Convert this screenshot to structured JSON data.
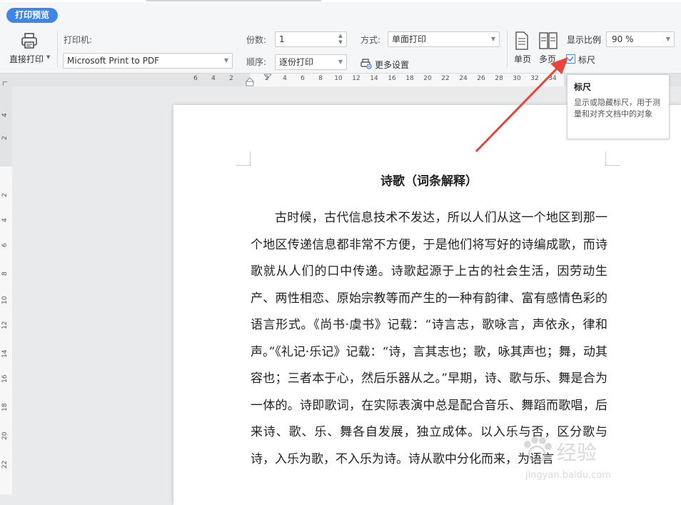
{
  "tab": {
    "label": "打印预览"
  },
  "direct_print": {
    "label": "直接打印"
  },
  "printer": {
    "label": "打印机:",
    "value": "Microsoft Print to PDF"
  },
  "copies": {
    "label": "份数:",
    "value": "1"
  },
  "order": {
    "label": "顺序:",
    "value": "逐份打印"
  },
  "mode": {
    "label": "方式:",
    "value": "单面打印"
  },
  "more_settings": {
    "label": "更多设置"
  },
  "single_page": {
    "label": "单页"
  },
  "multi_page": {
    "label": "多页"
  },
  "zoom": {
    "label": "显示比例",
    "value": "90 %"
  },
  "ruler_toggle": {
    "label": "标尺",
    "checked": true
  },
  "tooltip": {
    "title": "标尺",
    "description": "显示或隐藏标尺，用于测量和对齐文档中的对象"
  },
  "hruler_numbers": [
    "6",
    "4",
    "2",
    "2",
    "4",
    "6",
    "8",
    "10",
    "12",
    "14",
    "16",
    "18",
    "20",
    "22",
    "24",
    "26",
    "28",
    "30",
    "32",
    "34"
  ],
  "vruler_numbers": [
    "4",
    "2",
    "2",
    "4",
    "6",
    "8",
    "10",
    "12",
    "14",
    "16",
    "18",
    "20",
    "22"
  ],
  "document": {
    "title": "诗歌（词条解释）",
    "body": "古时候，古代信息技术不发达，所以人们从这一个地区到那一个地区传递信息都非常不方便，于是他们将写好的诗编成歌，而诗歌就从人们的口中传递。诗歌起源于上古的社会生活，因劳动生产、两性相恋、原始宗教等而产生的一种有韵律、富有感情色彩的语言形式。《尚书·虞书》记载：“诗言志，歌咏言，声依永，律和声。”《礼记·乐记》记载：“诗，言其志也；歌，咏其声也；舞，动其容也；三者本于心，然后乐器从之。”早期，诗、歌与乐、舞是合为一体的。诗即歌词，在实际表演中总是配合音乐、舞蹈而歌唱，后来诗、歌、乐、舞各自发展，独立成体。以入乐与否，区分歌与诗，入乐为歌，不入乐为诗。诗从歌中分化而来，为语言"
  },
  "watermark": {
    "text": "经验",
    "url": "jingyan.baidu.com"
  },
  "colors": {
    "accent": "#3f86e8",
    "arrow": "#e8443a"
  }
}
